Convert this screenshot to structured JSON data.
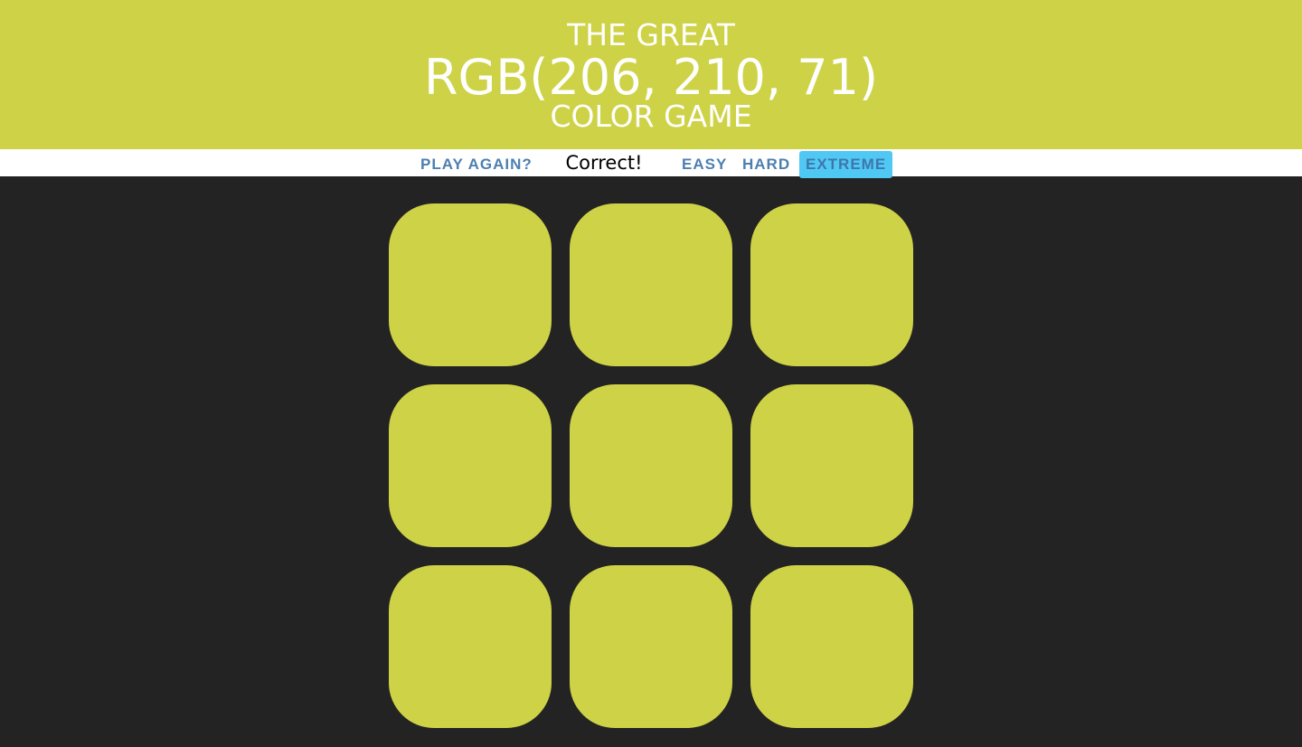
{
  "header": {
    "title_line_1": "THE GREAT",
    "target_color_display": "RGB(206, 210, 71)",
    "title_line_3": "COLOR GAME",
    "background_color": "#CED247"
  },
  "stripe": {
    "reset_label": "PLAY AGAIN?",
    "message": "Correct!",
    "modes": [
      {
        "label": "EASY",
        "selected": false
      },
      {
        "label": "HARD",
        "selected": false
      },
      {
        "label": "EXTREME",
        "selected": true
      }
    ],
    "button_color": "#4C7FB0",
    "selected_color": "#4FC9F4"
  },
  "board": {
    "background_color": "#232323",
    "squares": [
      {
        "color": "#CED247"
      },
      {
        "color": "#CED247"
      },
      {
        "color": "#CED247"
      },
      {
        "color": "#CED247"
      },
      {
        "color": "#CED247"
      },
      {
        "color": "#CED247"
      },
      {
        "color": "#CED247"
      },
      {
        "color": "#CED247"
      },
      {
        "color": "#CED247"
      }
    ]
  }
}
